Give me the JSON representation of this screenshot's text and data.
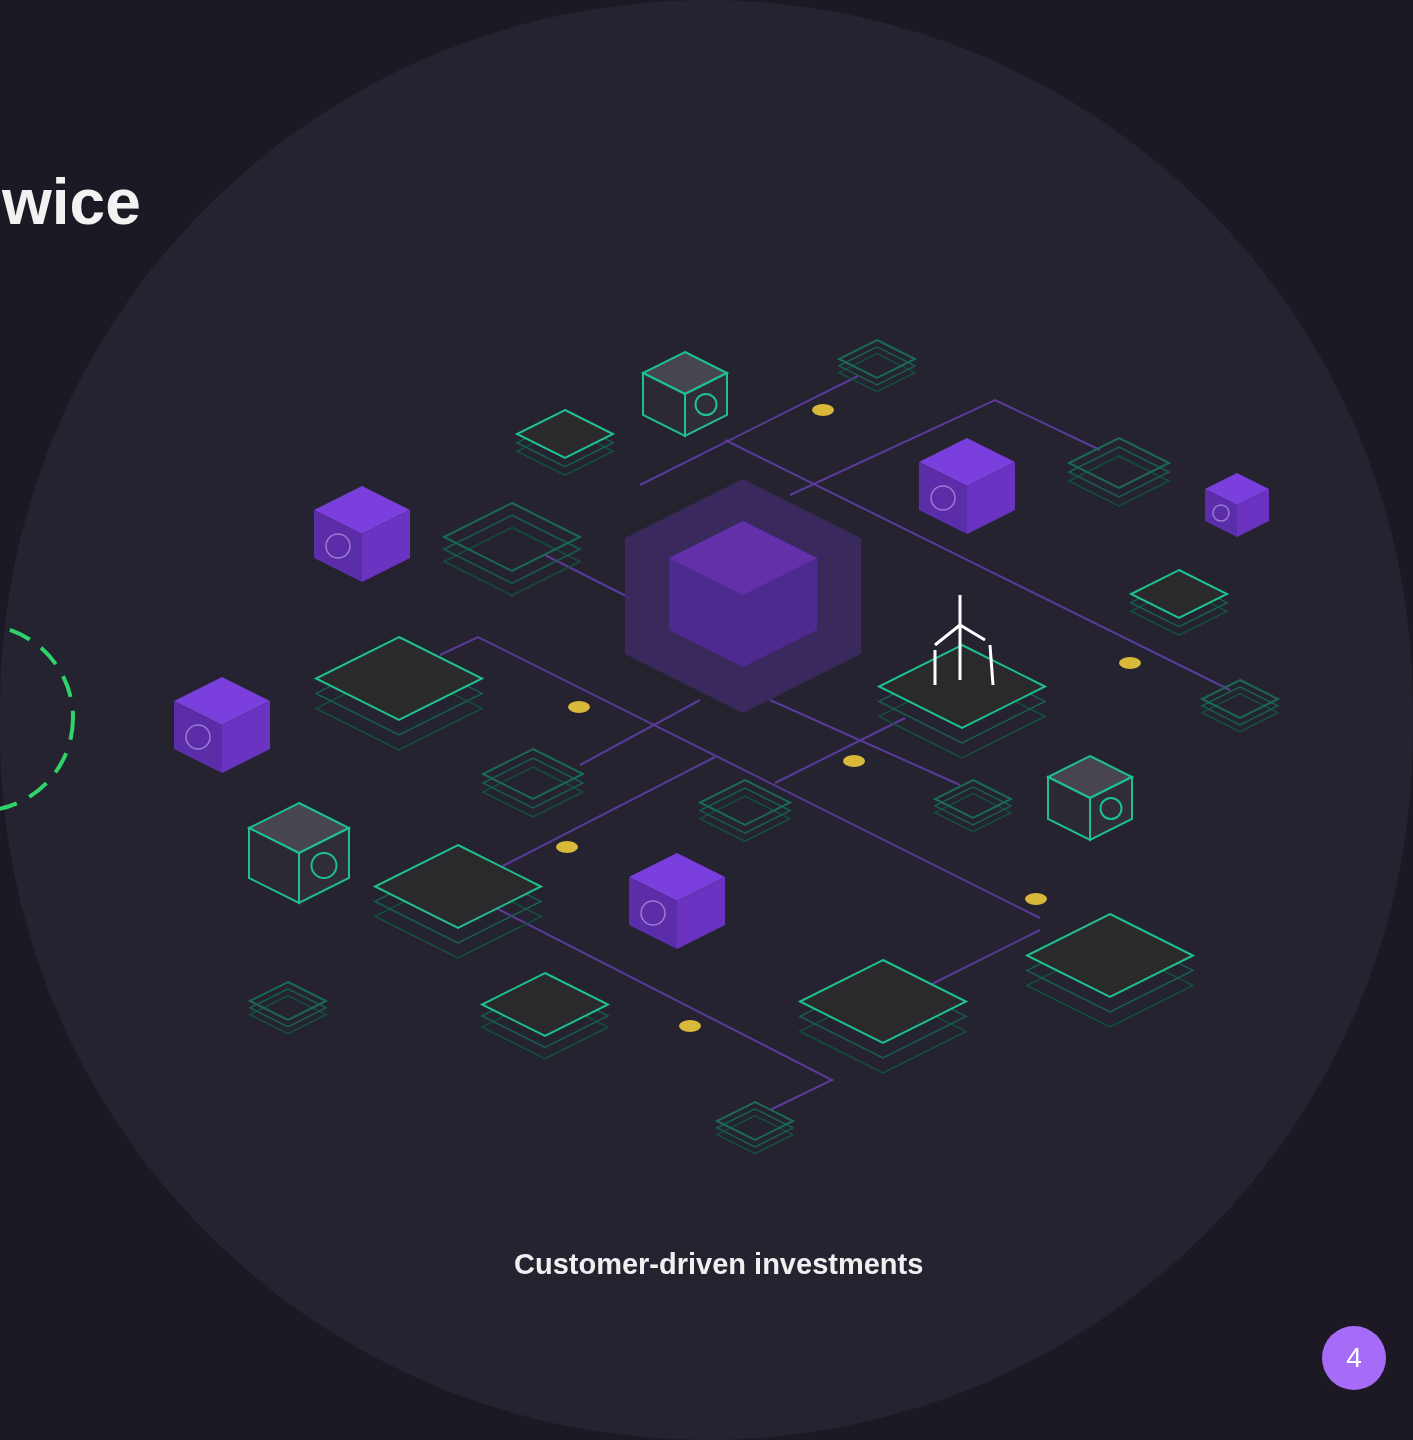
{
  "heading": "wice",
  "caption": "Customer-driven investments",
  "page_number": "4"
}
